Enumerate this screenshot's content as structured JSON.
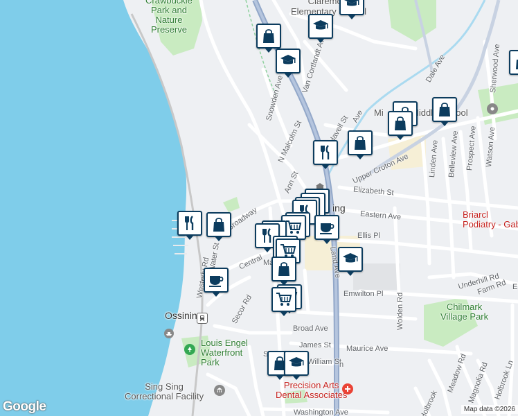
{
  "map": {
    "attribution": "Map data ©2026",
    "logo": "Google",
    "colors": {
      "water": "#7fcdea",
      "land": "#eef0f3",
      "park": "#c9ebc1",
      "road": "#ffffff",
      "highway": "#93a8c9",
      "pin": "#0c3c5e"
    }
  },
  "labels": {
    "croton_park": "Crawbuckie\nPark and\nNature\nPreserve",
    "claremont_school": "Claremont\nElementary School",
    "middle_school": "Middle School",
    "ossining_place": "Ossining",
    "ossining_station": "Ossining",
    "louis_engel_park": "Louis Engel\nWaterfront\nPark",
    "sing_sing": "Sing Sing\nCorrectional Facility",
    "precision_arts": "Precision Arts\nDental Associates",
    "briarcliff": "Briarcl\nPodiatry - Gab",
    "chilmark": "Chilmark\nVillage Park",
    "streets": {
      "dale_ave": "Dale Ave",
      "van_cortlandt": "Van Cortlandt Ave",
      "snowden": "Snowden Ave",
      "n_malcolm": "N Malcolm St",
      "havell": "Havell St",
      "upper_croton": "Upper Croton Ave",
      "ann": "Ann St",
      "elizabeth": "Elizabeth St",
      "eastern": "Eastern Ave",
      "ellis": "Ellis Pl",
      "central": "Central",
      "broadway": "Broadway",
      "water": "Water St",
      "westerly": "Westerly Rd",
      "secor": "Secor Rd",
      "emwilton": "Emwilton Pl",
      "broad": "Broad Ave",
      "james": "James St",
      "maurice": "Maurice Ave",
      "william": "William St",
      "washington": "Washington Ave",
      "wolden": "Wolden Rd",
      "linden": "Linden Ave",
      "belleview": "Belleview Ave",
      "prospect": "Prospect Ave",
      "watson": "Watson Ave",
      "sherwood": "Sherwood Ave",
      "underhill": "Underhill Rd",
      "farm": "Farm Rd",
      "meadow": "Meadow Rd",
      "magnolia": "Magnolia Rd",
      "holbrook": "Holbrook Ln",
      "holbrook2": "Holbrook",
      "land_ave": "Land Ave",
      "stevens": "S",
      "ma": "Ma",
      "e": "E",
      "n": "n",
      "s_mid": "S",
      "ossining_frag": "ing",
      "mi": "Mi",
      "mr": "M"
    }
  },
  "pins": [
    {
      "icon": "school"
    },
    {
      "icon": "school"
    },
    {
      "icon": "shopping"
    },
    {
      "icon": "school"
    },
    {
      "icon": "shopping"
    },
    {
      "icon": "shopping"
    },
    {
      "icon": "shopping"
    },
    {
      "icon": "shopping"
    },
    {
      "icon": "restaurant"
    },
    {
      "icon": "shopping"
    },
    {
      "icon": "restaurant"
    },
    {
      "icon": "restaurant"
    },
    {
      "icon": "shopping"
    },
    {
      "icon": "restaurant"
    },
    {
      "icon": "restaurant"
    },
    {
      "icon": "grocery"
    },
    {
      "icon": "restaurant"
    },
    {
      "icon": "restaurant"
    },
    {
      "icon": "cafe"
    },
    {
      "icon": "restaurant"
    },
    {
      "icon": "grocery"
    },
    {
      "icon": "school"
    },
    {
      "icon": "shopping"
    },
    {
      "icon": "cafe"
    },
    {
      "icon": "grocery"
    },
    {
      "icon": "grocery"
    },
    {
      "icon": "shopping"
    },
    {
      "icon": "school"
    },
    {
      "icon": "shopping"
    }
  ]
}
